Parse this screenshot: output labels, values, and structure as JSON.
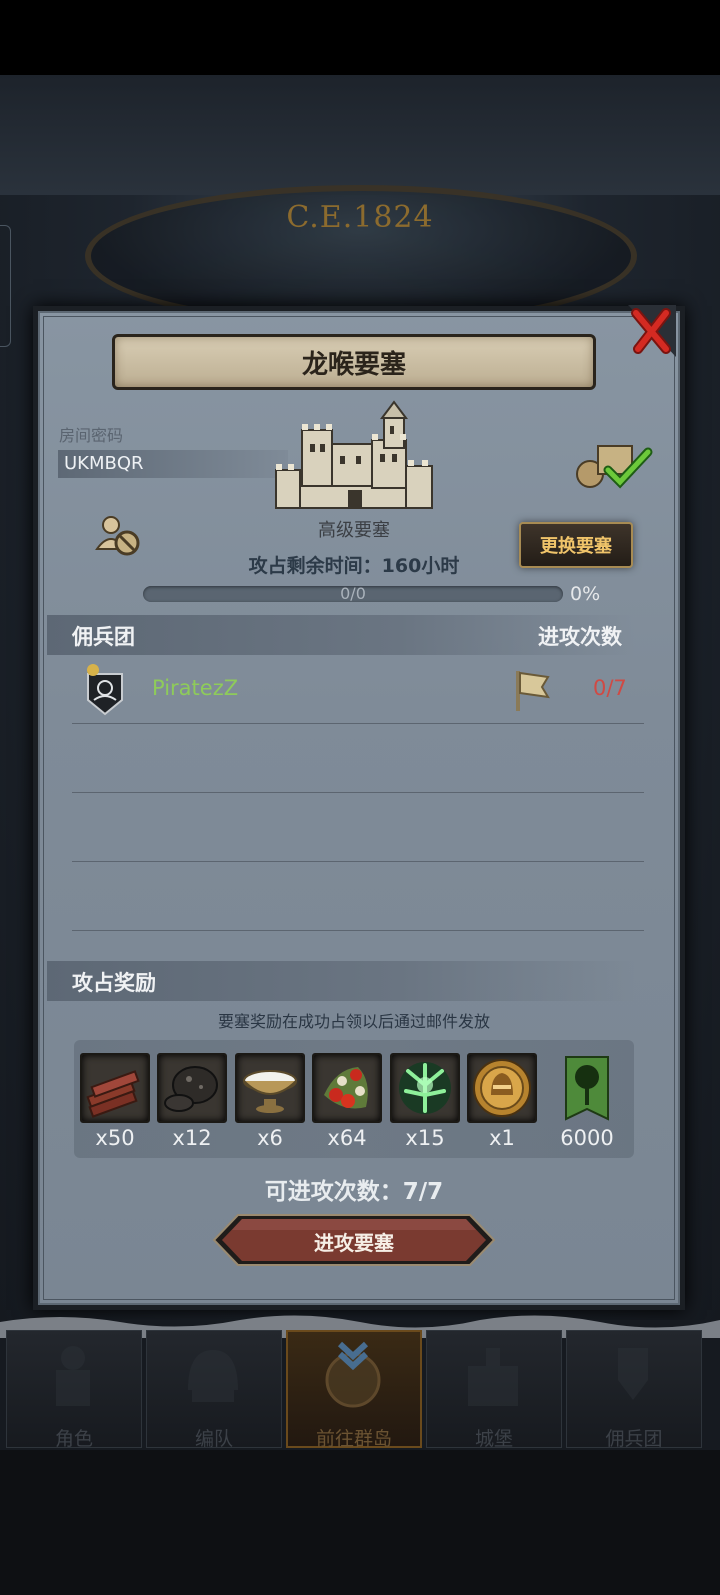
{
  "header": {
    "year": "C.E.1824"
  },
  "dialog": {
    "title": "龙喉要塞",
    "room": {
      "label": "房间密码",
      "code": "UKMBQR"
    },
    "fortress": {
      "tier": "高级要塞"
    },
    "change_button": "更换要塞",
    "timer_text": "攻占剩余时间：160小时",
    "progress": {
      "count_text": "0/0",
      "percent_text": "0%",
      "fraction": 0.0
    },
    "mercenary_section": {
      "title": "佣兵团",
      "attacks_header": "进攻次数"
    },
    "guilds": [
      {
        "name": "PiratezZ",
        "attacks": "0/7"
      }
    ],
    "rewards": {
      "title": "攻占奖励",
      "note": "要塞奖励在成功占领以后通过邮件发放",
      "items": [
        {
          "icon": "wood-icon",
          "qty": "x50"
        },
        {
          "icon": "ore-icon",
          "qty": "x12"
        },
        {
          "icon": "salt-bowl-icon",
          "qty": "x6"
        },
        {
          "icon": "berries-icon",
          "qty": "x64"
        },
        {
          "icon": "green-crystal-icon",
          "qty": "x15"
        },
        {
          "icon": "gold-medal-icon",
          "qty": "x1"
        },
        {
          "icon": "guild-banner-icon",
          "qty": "6000"
        }
      ]
    },
    "attempts_text": "可进攻次数：7/7",
    "attack_button": "进攻要塞"
  },
  "nav": {
    "tabs": [
      {
        "label": "角色",
        "icon": "knight-icon"
      },
      {
        "label": "编队",
        "icon": "helmet-icon"
      },
      {
        "label": "前往群岛",
        "icon": "compass-icon"
      },
      {
        "label": "城堡",
        "icon": "castle-icon"
      },
      {
        "label": "佣兵团",
        "icon": "mercenary-icon"
      }
    ]
  },
  "colors": {
    "panel": "#7f8b98",
    "accent_gold": "#f0c46a",
    "guild_name": "#8ecb5a",
    "attack_count": "#d04a44",
    "close_red": "#d42a22"
  }
}
